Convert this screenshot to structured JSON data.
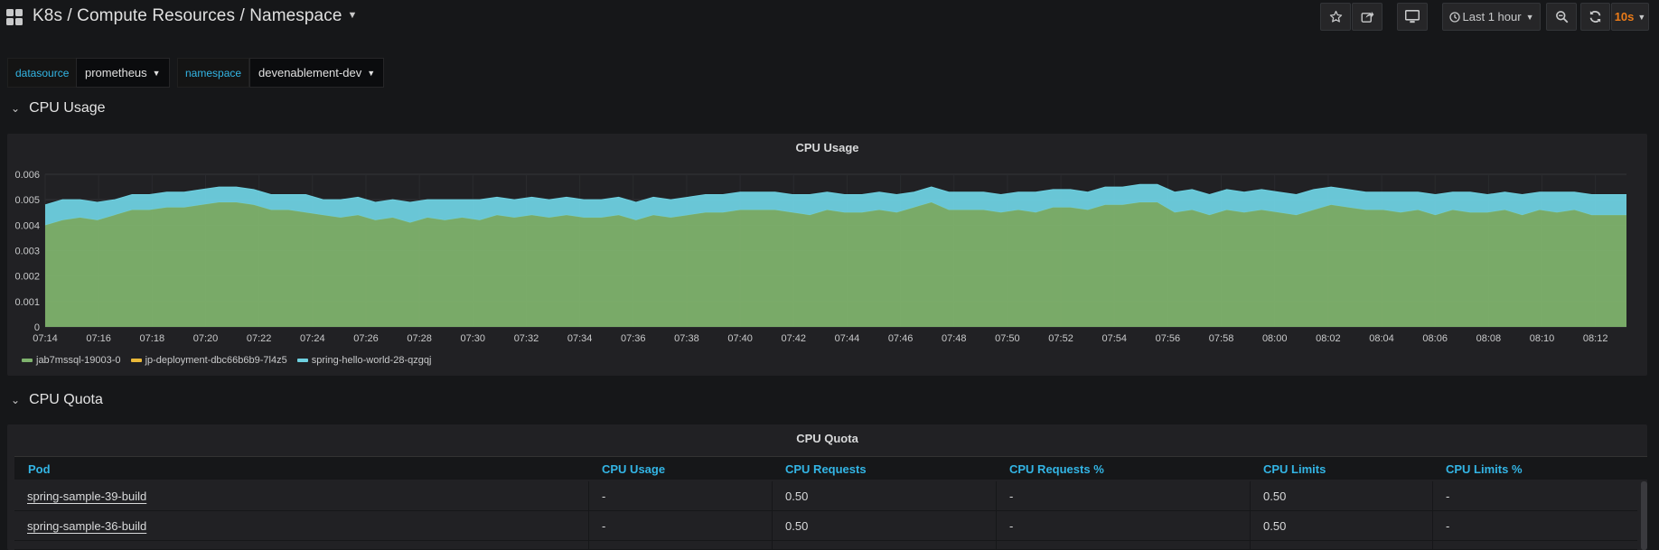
{
  "header": {
    "title": "K8s / Compute Resources / Namespace",
    "time_range": "Last 1 hour",
    "refresh": "10s"
  },
  "variables": [
    {
      "label": "datasource",
      "value": "prometheus"
    },
    {
      "label": "namespace",
      "value": "devenablement-dev"
    }
  ],
  "rows": {
    "cpu_usage": "CPU Usage",
    "cpu_quota": "CPU Quota"
  },
  "cpu_usage_panel": {
    "title": "CPU Usage"
  },
  "chart_data": {
    "type": "area",
    "stacked": true,
    "ylim": [
      0,
      0.006
    ],
    "yticks": [
      "0",
      "0.001",
      "0.002",
      "0.003",
      "0.004",
      "0.005",
      "0.006"
    ],
    "xticks": [
      "07:14",
      "07:16",
      "07:18",
      "07:20",
      "07:22",
      "07:24",
      "07:26",
      "07:28",
      "07:30",
      "07:32",
      "07:34",
      "07:36",
      "07:38",
      "07:40",
      "07:42",
      "07:44",
      "07:46",
      "07:48",
      "07:50",
      "07:52",
      "07:54",
      "07:56",
      "07:58",
      "08:00",
      "08:02",
      "08:04",
      "08:06",
      "08:08",
      "08:10",
      "08:12"
    ],
    "legend_position": "bottom-left",
    "grid": true,
    "series": [
      {
        "name": "jab7mssql-19003-0",
        "color": "#7eb26d",
        "values": [
          0.004,
          0.0042,
          0.0043,
          0.0042,
          0.0044,
          0.0046,
          0.0046,
          0.0047,
          0.0047,
          0.0048,
          0.0049,
          0.0049,
          0.0048,
          0.0046,
          0.0046,
          0.0045,
          0.0044,
          0.0043,
          0.0044,
          0.0042,
          0.0043,
          0.0041,
          0.0043,
          0.0042,
          0.0043,
          0.0042,
          0.0044,
          0.0043,
          0.0044,
          0.0043,
          0.0044,
          0.0043,
          0.0043,
          0.0044,
          0.0042,
          0.0044,
          0.0043,
          0.0044,
          0.0045,
          0.0045,
          0.0046,
          0.0046,
          0.0046,
          0.0045,
          0.0044,
          0.0046,
          0.0045,
          0.0045,
          0.0046,
          0.0045,
          0.0047,
          0.0049,
          0.0046,
          0.0046,
          0.0046,
          0.0045,
          0.0046,
          0.0045,
          0.0047,
          0.0047,
          0.0046,
          0.0048,
          0.0048,
          0.0049,
          0.0049,
          0.0045,
          0.0046,
          0.0044,
          0.0046,
          0.0045,
          0.0046,
          0.0045,
          0.0044,
          0.0046,
          0.0048,
          0.0047,
          0.0046,
          0.0046,
          0.0045,
          0.0046,
          0.0044,
          0.0046,
          0.0045,
          0.0045,
          0.0046,
          0.0044,
          0.0046,
          0.0045,
          0.0046,
          0.0044,
          0.0044,
          0.0044
        ]
      },
      {
        "name": "jp-deployment-dbc66b6b9-7l4z5",
        "color": "#eab839",
        "values": [
          0,
          0,
          0,
          0,
          0,
          0,
          0,
          0,
          0,
          0,
          0,
          0,
          0,
          0,
          0,
          0,
          0,
          0,
          0,
          0,
          0,
          0,
          0,
          0,
          0,
          0,
          0,
          0,
          0,
          0,
          0,
          0,
          0,
          0,
          0,
          0,
          0,
          0,
          0,
          0,
          0,
          0,
          0,
          0,
          0,
          0,
          0,
          0,
          0,
          0,
          0,
          0,
          0,
          0,
          0,
          0,
          0,
          0,
          0,
          0,
          0,
          0,
          0,
          0,
          0,
          0,
          0,
          0,
          0,
          0,
          0,
          0,
          0,
          0,
          0,
          0,
          0,
          0,
          0,
          0,
          0,
          0,
          0,
          0,
          0,
          0,
          0,
          0,
          0,
          0,
          0,
          0
        ]
      },
      {
        "name": "spring-hello-world-28-qzgqj",
        "color": "#6ed0e0",
        "values": [
          0.0008,
          0.0008,
          0.0007,
          0.0007,
          0.0006,
          0.0006,
          0.0006,
          0.0006,
          0.0006,
          0.0006,
          0.0006,
          0.0006,
          0.0006,
          0.0006,
          0.0006,
          0.0007,
          0.0006,
          0.0007,
          0.0007,
          0.0007,
          0.0007,
          0.0008,
          0.0007,
          0.0008,
          0.0007,
          0.0008,
          0.0007,
          0.0007,
          0.0007,
          0.0007,
          0.0007,
          0.0007,
          0.0007,
          0.0007,
          0.0007,
          0.0007,
          0.0007,
          0.0007,
          0.0007,
          0.0007,
          0.0007,
          0.0007,
          0.0007,
          0.0007,
          0.0008,
          0.0007,
          0.0007,
          0.0007,
          0.0007,
          0.0007,
          0.0006,
          0.0006,
          0.0007,
          0.0007,
          0.0007,
          0.0007,
          0.0007,
          0.0008,
          0.0007,
          0.0007,
          0.0007,
          0.0007,
          0.0007,
          0.0007,
          0.0007,
          0.0008,
          0.0008,
          0.0008,
          0.0008,
          0.0008,
          0.0008,
          0.0008,
          0.0008,
          0.0008,
          0.0007,
          0.0007,
          0.0007,
          0.0007,
          0.0008,
          0.0007,
          0.0008,
          0.0007,
          0.0008,
          0.0007,
          0.0007,
          0.0008,
          0.0007,
          0.0008,
          0.0007,
          0.0008,
          0.0008,
          0.0008
        ]
      }
    ]
  },
  "cpu_quota_panel": {
    "title": "CPU Quota",
    "columns": [
      "Pod",
      "CPU Usage",
      "CPU Requests",
      "CPU Requests %",
      "CPU Limits",
      "CPU Limits %"
    ],
    "rows": [
      [
        "spring-sample-39-build",
        "-",
        "0.50",
        "-",
        "0.50",
        "-"
      ],
      [
        "spring-sample-36-build",
        "-",
        "0.50",
        "-",
        "0.50",
        "-"
      ],
      [
        "",
        "",
        "",
        "",
        "",
        ""
      ]
    ]
  }
}
